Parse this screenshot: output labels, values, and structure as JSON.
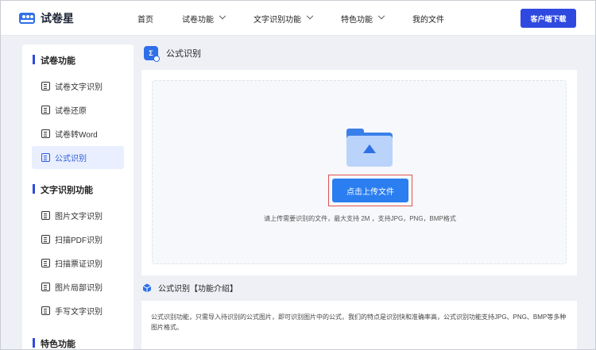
{
  "brand": {
    "name": "试卷星"
  },
  "nav": {
    "items": [
      {
        "label": "首页",
        "dropdown": false
      },
      {
        "label": "试卷功能",
        "dropdown": true
      },
      {
        "label": "文字识别功能",
        "dropdown": true
      },
      {
        "label": "特色功能",
        "dropdown": true
      },
      {
        "label": "我的文件",
        "dropdown": false
      }
    ],
    "cta_label": "客户端下载"
  },
  "sidebar": {
    "sections": [
      {
        "title": "试卷功能",
        "items": [
          {
            "label": "试卷文字识别",
            "active": false
          },
          {
            "label": "试卷还原",
            "active": false
          },
          {
            "label": "试卷转Word",
            "active": false
          },
          {
            "label": "公式识别",
            "active": true
          }
        ]
      },
      {
        "title": "文字识别功能",
        "items": [
          {
            "label": "图片文字识别",
            "active": false
          },
          {
            "label": "扫描PDF识别",
            "active": false
          },
          {
            "label": "扫描票证识别",
            "active": false
          },
          {
            "label": "图片局部识别",
            "active": false
          },
          {
            "label": "手写文字识别",
            "active": false
          }
        ]
      },
      {
        "title": "特色功能",
        "items": []
      }
    ]
  },
  "main": {
    "title": "公式识别",
    "upload_button": "点击上传文件",
    "upload_hint": "请上传需要识别的文件，最大支持 2M ，支持JPG，PNG，BMP格式",
    "intro_title": "公式识别【功能介绍】",
    "intro_text": "公式识别功能，只需导入待识别的公式图片，即可识别图片中的公式，我们的特点是识别快和准确率高，公式识别功能支持JPG、PNG、BMP等多种图片格式。"
  },
  "colors": {
    "accent": "#2f49e0",
    "upload_button": "#2a7ef0",
    "highlight_border": "#e05252",
    "active_bg": "#e9efff"
  }
}
